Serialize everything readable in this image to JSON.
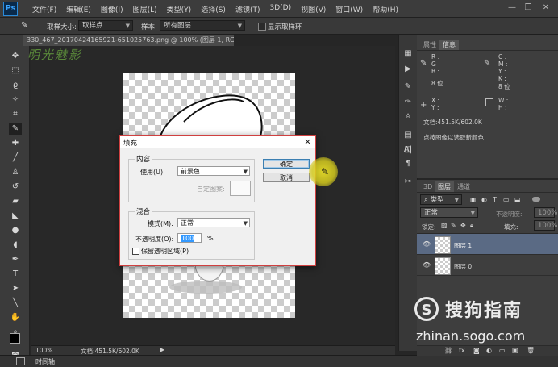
{
  "app": {
    "logo": "Ps"
  },
  "menu": [
    "文件(F)",
    "编辑(E)",
    "图像(I)",
    "图层(L)",
    "类型(Y)",
    "选择(S)",
    "滤镜(T)",
    "3D(D)",
    "视图(V)",
    "窗口(W)",
    "帮助(H)"
  ],
  "window_controls": [
    "—",
    "❐",
    "✕"
  ],
  "options": {
    "sample_size_label": "取样大小:",
    "sample_size_value": "取样点",
    "sample_label": "样本:",
    "sample_value": "所有图层",
    "show_ring_label": "显示取样环"
  },
  "document": {
    "tab_title": "330_467_20170424165921-651025763.png @ 100% (图层 1, RGB/8#) *  ×",
    "watermark_text": "明光魅影"
  },
  "status": {
    "zoom": "100%",
    "doc_size": "文档:451.5K/602.0K",
    "timeline_tab": "时间轴"
  },
  "info_panel": {
    "tabs": [
      "属性",
      "信息"
    ],
    "rgb": [
      "R :",
      "G :",
      "B :"
    ],
    "rgb_bits": "8 位",
    "cmyk": [
      "C :",
      "M :",
      "Y :",
      "K :"
    ],
    "cmyk_bits": "8 位",
    "xy": [
      "X :",
      "Y :"
    ],
    "wh": [
      "W :",
      "H :"
    ],
    "doc_size": "文档:451.5K/602.0K",
    "hint": "点按图像以选取新颜色"
  },
  "layers_panel": {
    "tabs": [
      "3D",
      "图层",
      "通道"
    ],
    "filter_type": "类型",
    "blend_mode": "正常",
    "opacity_label": "不透明度:",
    "opacity_value": "100%",
    "lock_label": "锁定:",
    "fill_label": "填充:",
    "fill_value": "100%",
    "layers": [
      {
        "name": "图层 1",
        "selected": true
      },
      {
        "name": "图层 0",
        "selected": false
      }
    ],
    "footer_icons": [
      "link-icon",
      "fx-icon",
      "mask-icon",
      "adjustment-icon",
      "group-icon",
      "new-layer-icon",
      "trash-icon"
    ]
  },
  "fill_dialog": {
    "title": "填充",
    "close": "×",
    "content_group": "内容",
    "use_label": "使用(U):",
    "use_value": "前景色",
    "custom_pattern_label": "自定图案:",
    "blending_group": "混合",
    "mode_label": "模式(M):",
    "mode_value": "正常",
    "opacity_label": "不透明度(O):",
    "opacity_value": "100",
    "opacity_unit": "%",
    "preserve_label": "保留透明区域(P)",
    "ok_label": "确定",
    "cancel_label": "取消"
  },
  "sogou": {
    "name": "搜狗指南",
    "url": "zhinan.sogo.com",
    "logo": "S"
  },
  "colors": {
    "accent": "#2a8ad8",
    "dialog_border": "#d04040",
    "selected_layer": "#5a6a84",
    "cursor_glow": "#e6dc28"
  }
}
